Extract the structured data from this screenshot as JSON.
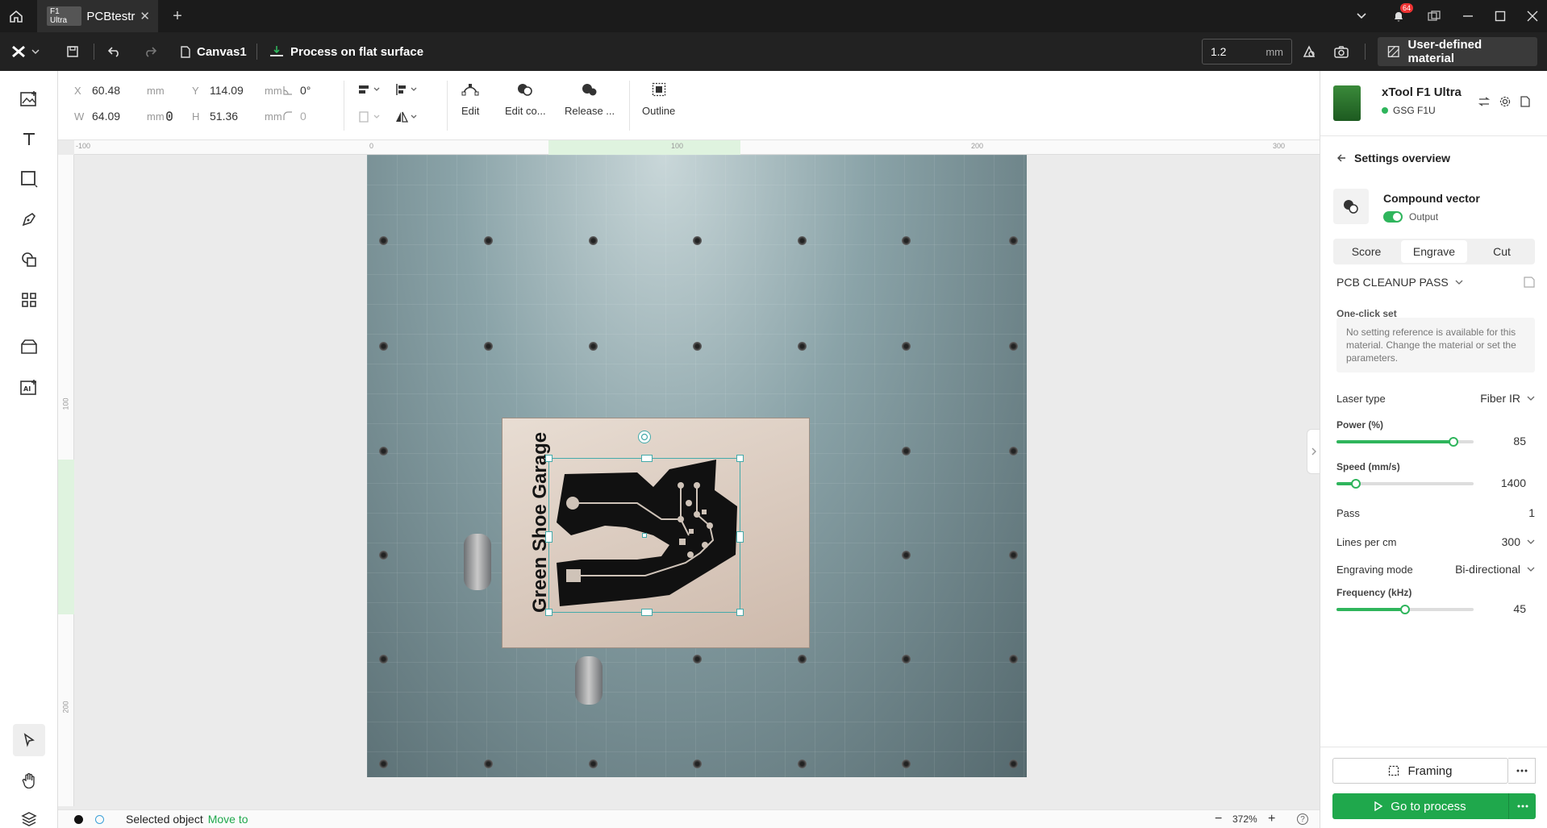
{
  "titlebar": {
    "tab_badge": "F1 Ultra",
    "tab_title": "PCBtestr",
    "notification_count": "64"
  },
  "toolbar": {
    "canvas_name": "Canvas1",
    "process_mode": "Process on flat surface",
    "thickness_value": "1.2",
    "thickness_unit": "mm",
    "material_label": "User-defined material"
  },
  "props": {
    "x_label": "X",
    "x_value": "60.48",
    "x_unit": "mm",
    "y_label": "Y",
    "y_value": "114.09",
    "y_unit": "mm",
    "rotation_value": "0°",
    "w_label": "W",
    "w_value": "64.09",
    "w_unit": "mm",
    "h_label": "H",
    "h_value": "51.36",
    "h_unit": "mm",
    "corner_value": "0",
    "edit_label": "Edit",
    "edit_compound_label": "Edit co...",
    "release_label": "Release ...",
    "outline_label": "Outline"
  },
  "ruler": {
    "top_ticks": [
      "-100",
      "0",
      "100",
      "200",
      "300"
    ],
    "left_ticks": [
      "100",
      "200"
    ]
  },
  "canvas": {
    "board_text": "Green Shoe Garage"
  },
  "device": {
    "name": "xTool F1 Ultra",
    "status": "GSG F1U"
  },
  "panel": {
    "back_label": "Settings overview",
    "object_type": "Compound vector",
    "output_label": "Output",
    "tabs": [
      "Score",
      "Engrave",
      "Cut"
    ],
    "active_tab": "Engrave",
    "preset_name": "PCB CLEANUP PASS",
    "one_click_label": "One-click set",
    "notice": "No setting reference is available for this material. Change the material or set the parameters.",
    "laser_type_label": "Laser type",
    "laser_type_value": "Fiber IR",
    "power_label": "Power (%)",
    "power_value": "85",
    "speed_label": "Speed (mm/s)",
    "speed_value": "1400",
    "pass_label": "Pass",
    "pass_value": "1",
    "lines_label": "Lines per cm",
    "lines_value": "300",
    "mode_label": "Engraving mode",
    "mode_value": "Bi-directional",
    "freq_label": "Frequency (kHz)",
    "freq_value": "45",
    "framing_label": "Framing",
    "process_label": "Go to process"
  },
  "status": {
    "selected_text": "Selected object",
    "move_to_label": "Move to",
    "zoom_value": "372%"
  },
  "colors": {
    "accent": "#1fa84c",
    "dark_bar": "#222222"
  }
}
